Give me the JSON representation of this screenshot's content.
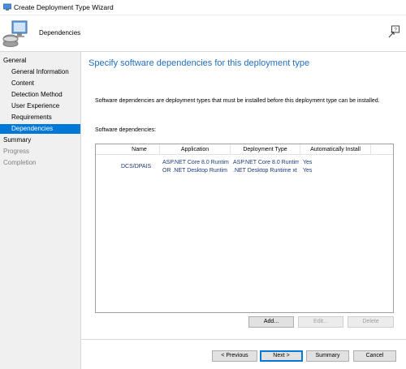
{
  "window": {
    "title": "Create Deployment Type Wizard",
    "icon": "wizard-app-icon"
  },
  "banner": {
    "title": "Dependencies",
    "icon": "computer-setup-icon",
    "help_icon": "help-pointer-icon"
  },
  "nav": {
    "items": [
      {
        "label": "General",
        "level": "top",
        "state": "normal"
      },
      {
        "label": "General Information",
        "level": "sub",
        "state": "normal"
      },
      {
        "label": "Content",
        "level": "sub",
        "state": "normal"
      },
      {
        "label": "Detection Method",
        "level": "sub",
        "state": "normal"
      },
      {
        "label": "User Experience",
        "level": "sub",
        "state": "normal"
      },
      {
        "label": "Requirements",
        "level": "sub",
        "state": "normal"
      },
      {
        "label": "Dependencies",
        "level": "sub",
        "state": "selected"
      },
      {
        "label": "Summary",
        "level": "top",
        "state": "normal"
      },
      {
        "label": "Progress",
        "level": "top",
        "state": "dim"
      },
      {
        "label": "Completion",
        "level": "top",
        "state": "dim"
      }
    ]
  },
  "page": {
    "heading": "Specify software dependencies for this deployment type",
    "description": "Software dependencies are deployment types that must be installed before this deployment type can be installed.",
    "deps_label": "Software dependencies:"
  },
  "table": {
    "columns": [
      "Name",
      "Application",
      "Deployment Type",
      "Automatically Install"
    ],
    "group_name": "DCS/DPAIS",
    "rows": [
      {
        "application": "ASP.NET Core 8.0 Runtim",
        "deployment_type": "ASP.NET Core 8.0 Runtim",
        "auto_install": "Yes"
      },
      {
        "application": "OR .NET Desktop Runtim",
        "deployment_type": ".NET Desktop Runtime xt",
        "auto_install": "Yes"
      }
    ]
  },
  "list_buttons": {
    "add": "Add...",
    "edit": "Edit...",
    "delete": "Delete"
  },
  "footer_buttons": {
    "previous": "< Previous",
    "next": "Next >",
    "summary": "Summary",
    "cancel": "Cancel"
  },
  "colors": {
    "accent": "#0078d7",
    "heading": "#1e6fc2",
    "nav_bg": "#f0f0f0"
  }
}
